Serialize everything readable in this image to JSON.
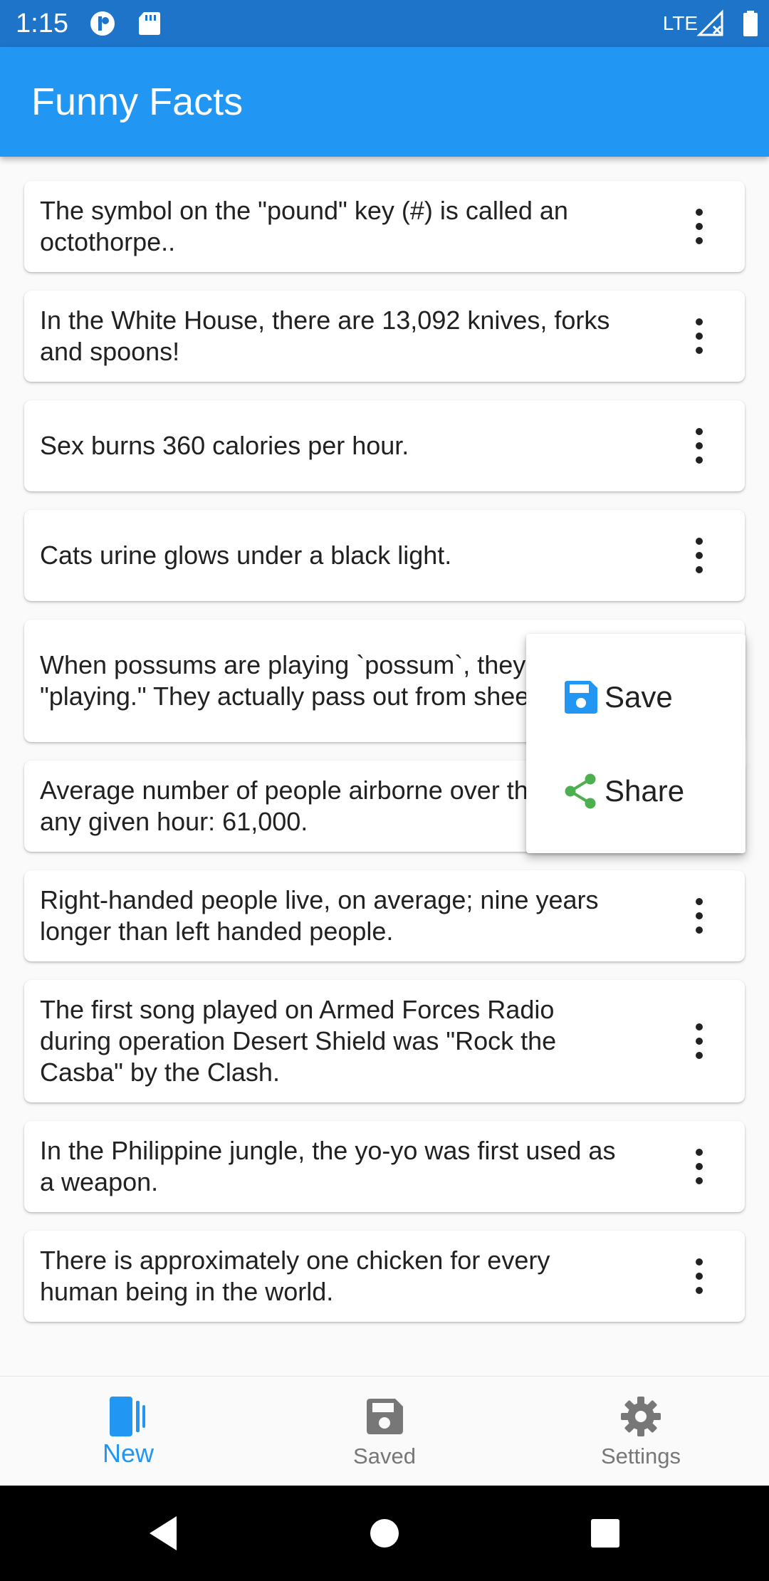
{
  "status_bar": {
    "time": "1:15",
    "network": "LTE",
    "icons": [
      "notification-icon",
      "sd-card-icon",
      "signal-icon",
      "battery-icon"
    ]
  },
  "app_bar": {
    "title": "Funny Facts",
    "color": "#2196f3"
  },
  "facts": [
    {
      "text": "The symbol on the \"pound\" key (#) is called an octothorpe.."
    },
    {
      "text": "In the White House, there are 13,092 knives, forks and spoons!"
    },
    {
      "text": "Sex burns 360 calories per hour."
    },
    {
      "text": "Cats urine glows under a black light."
    },
    {
      "text": "When possums are playing `possum`, they are not \"playing.\" They actually pass out from sheer terror."
    },
    {
      "text": "Average number of people airborne over the U.S. any given hour: 61,000."
    },
    {
      "text": "Right-handed people live, on average; nine years longer than left handed people."
    },
    {
      "text": "The first song played on Armed Forces Radio during operation Desert Shield was \"Rock the Casba\" by the Clash."
    },
    {
      "text": "In the Philippine jungle, the yo-yo was first used as a weapon."
    },
    {
      "text": "There is approximately one chicken for every human being in the world."
    }
  ],
  "popup_menu": {
    "items": [
      {
        "label": "Save",
        "icon": "save-icon",
        "icon_color": "#2196f3"
      },
      {
        "label": "Share",
        "icon": "share-icon",
        "icon_color": "#4caf50"
      }
    ]
  },
  "bottom_nav": {
    "items": [
      {
        "label": "New",
        "icon": "new-icon",
        "active": true
      },
      {
        "label": "Saved",
        "icon": "save-icon",
        "active": false
      },
      {
        "label": "Settings",
        "icon": "gear-icon",
        "active": false
      }
    ],
    "active_color": "#2196f3",
    "inactive_color": "#777777"
  },
  "system_nav": {
    "buttons": [
      "back-icon",
      "home-icon",
      "recents-icon"
    ]
  }
}
